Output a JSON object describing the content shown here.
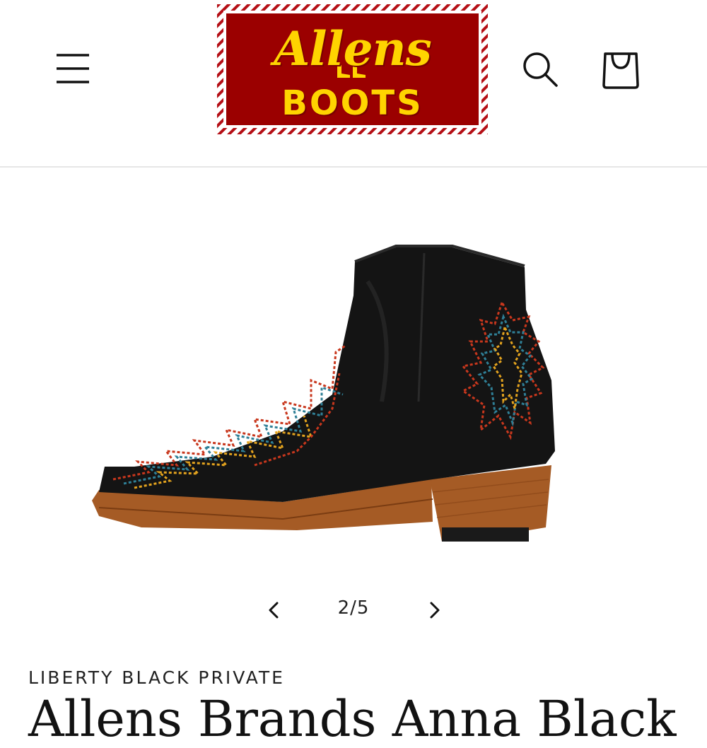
{
  "header": {
    "logo": {
      "script_text": "Allens",
      "bold_text": "BOOTS",
      "background_color": "#9b0000",
      "text_color": "#ffd400"
    },
    "menu_icon": "hamburger-menu-icon",
    "search_icon": "search-icon",
    "cart_icon": "shopping-bag-icon"
  },
  "gallery": {
    "image_subject": "black ankle boot with multicolor embroidery and stacked wooden heel",
    "prev_icon": "chevron-left-icon",
    "next_icon": "chevron-right-icon",
    "counter": "2/5"
  },
  "product": {
    "vendor": "LIBERTY BLACK PRIVATE",
    "title": "Allens Brands Anna Black"
  },
  "colors": {
    "boot_leather": "#141414",
    "heel_wood": "#a55b25",
    "stitch_red": "#c8371d",
    "stitch_blue": "#2f7f96",
    "stitch_yellow": "#e2a21e"
  }
}
